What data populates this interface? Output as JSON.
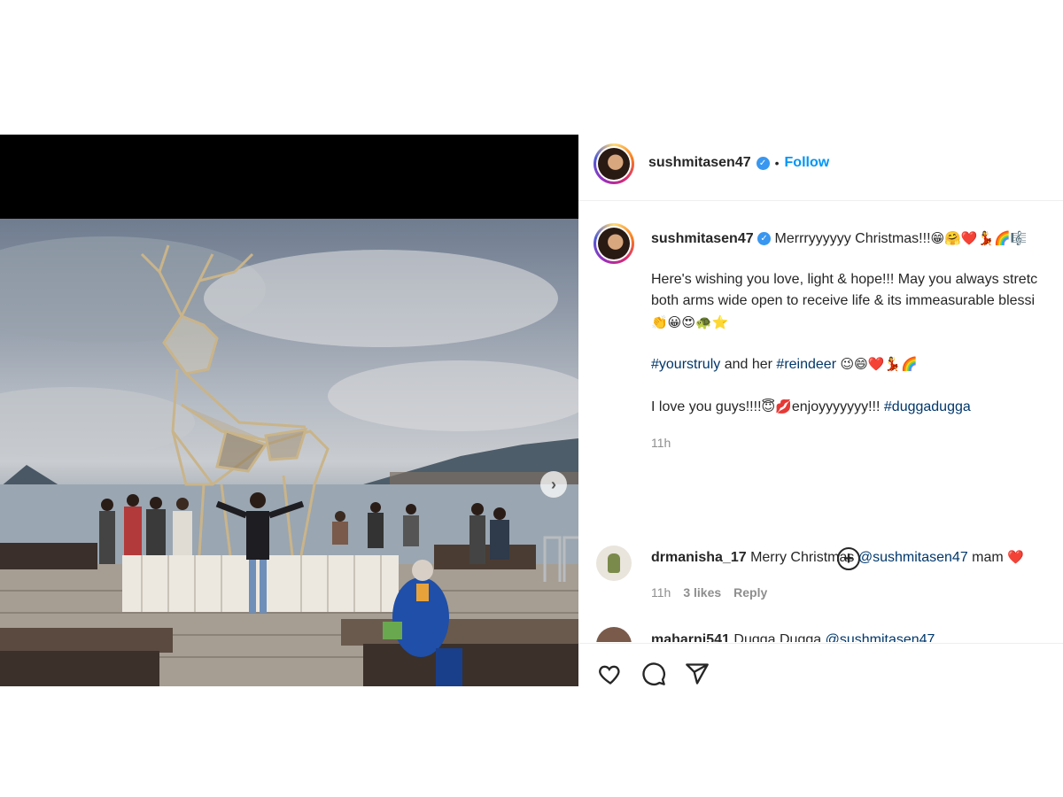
{
  "post": {
    "author": "sushmitasen47",
    "follow_label": "Follow",
    "separator": "•"
  },
  "caption": {
    "username": "sushmitasen47",
    "line1": "Merrryyyyyy Christmas!!!",
    "line1_emojis": "😁🤗❤️💃🌈🎼",
    "line2": "Here's wishing you love, light & hope!!! May you always stretc",
    "line3": "both arms wide open to receive life & its immeasurable blessi",
    "line4_emojis": "👏😀😍🐢⭐",
    "hashtag1": "#yourstruly",
    "and_her": "and her",
    "hashtag2": "#reindeer",
    "line5_emojis": "😉😄❤️💃🌈",
    "line6": "I love you guys!!!!",
    "line6_emoji1": "😇💋",
    "line6_mid": "enjoyyyyyyy!!!",
    "hashtag3": "#duggadugga",
    "time": "11h"
  },
  "comments": [
    {
      "username": "drmanisha_17",
      "text": "Merry Christmas",
      "mention": "@sushmitasen47",
      "suffix": "mam",
      "emoji": "❤️",
      "time": "11h",
      "likes": "3 likes",
      "reply": "Reply"
    },
    {
      "username": "maharni541",
      "text": "Dugga Dugga",
      "mention": "@sushmitasen47"
    }
  ],
  "icons": {
    "verified": "verified-badge-icon",
    "add": "plus-circle-icon",
    "like": "heart-icon",
    "comment": "comment-icon",
    "share": "send-icon",
    "next": "chevron-right-icon"
  },
  "colors": {
    "link": "#00376b",
    "follow": "#0095f6",
    "muted": "#8e8e8e",
    "verified": "#3897f0"
  }
}
